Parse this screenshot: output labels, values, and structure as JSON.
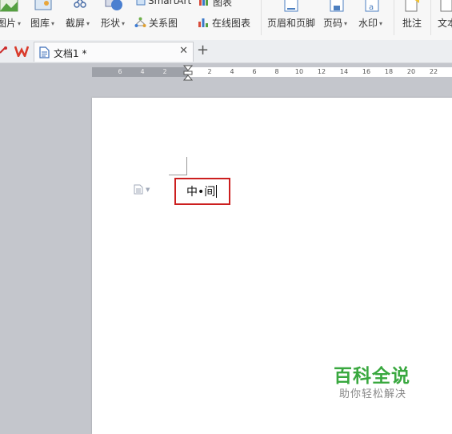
{
  "ribbon": {
    "picture": "图片",
    "gallery": "图库",
    "screenshot": "截屏",
    "shapes": "形状",
    "smartart": "SmartArt",
    "chart": "图表",
    "relations": "关系图",
    "online_chart": "在线图表",
    "header_footer": "页眉和页脚",
    "page_number": "页码",
    "watermark": "水印",
    "comment": "批注",
    "textbox": "文本"
  },
  "tabs": [
    {
      "title": "文档1 *"
    }
  ],
  "ruler": {
    "left_ticks": [
      "6",
      "4",
      "2"
    ],
    "right_ticks": [
      "2",
      "4",
      "6",
      "8",
      "10",
      "12",
      "14",
      "16",
      "18",
      "20",
      "22"
    ]
  },
  "document": {
    "text": "中•间"
  },
  "watermark": {
    "title": "百科全说",
    "subtitle": "助你轻松解决"
  },
  "colors": {
    "highlight": "#cc1f1f",
    "watermark_green": "#39a83f",
    "app_red": "#d93a2b"
  }
}
